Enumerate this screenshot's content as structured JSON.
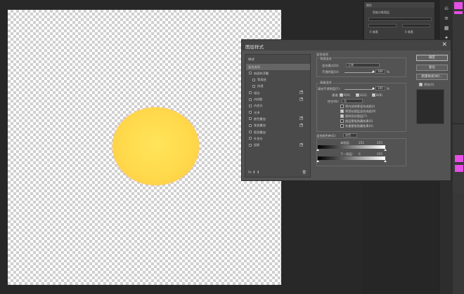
{
  "colors": {
    "sun_core": "#ffe45a",
    "sun_edge": "#f9b560",
    "accent_magenta": "#e54fe5"
  },
  "properties_panel": {
    "title": "属性",
    "subtitle": "智能对象图层",
    "field_a": "0 像素",
    "field_b": "0 像素"
  },
  "dialog": {
    "title": "图层样式",
    "sidebar_title": "样式",
    "sidebar_items": [
      {
        "label": "混合选项",
        "checkbox": false,
        "active": true,
        "sub": false,
        "plus": false
      },
      {
        "label": "斜面和浮雕",
        "checkbox": true,
        "active": false,
        "sub": false,
        "plus": false
      },
      {
        "label": "等高线",
        "checkbox": true,
        "active": false,
        "sub": true,
        "plus": false
      },
      {
        "label": "纹理",
        "checkbox": true,
        "active": false,
        "sub": true,
        "plus": false
      },
      {
        "label": "描边",
        "checkbox": true,
        "active": false,
        "sub": false,
        "plus": true
      },
      {
        "label": "内阴影",
        "checkbox": true,
        "active": false,
        "sub": false,
        "plus": true
      },
      {
        "label": "内发光",
        "checkbox": true,
        "active": false,
        "sub": false,
        "plus": false
      },
      {
        "label": "光泽",
        "checkbox": true,
        "active": false,
        "sub": false,
        "plus": false
      },
      {
        "label": "颜色叠加",
        "checkbox": true,
        "active": false,
        "sub": false,
        "plus": true
      },
      {
        "label": "渐变叠加",
        "checkbox": true,
        "active": false,
        "sub": false,
        "plus": true
      },
      {
        "label": "图案叠加",
        "checkbox": true,
        "active": false,
        "sub": false,
        "plus": false
      },
      {
        "label": "外发光",
        "checkbox": true,
        "active": false,
        "sub": false,
        "plus": false
      },
      {
        "label": "投影",
        "checkbox": true,
        "active": false,
        "sub": false,
        "plus": true
      }
    ],
    "sidebar_footer": "fx ⬆ ⬇",
    "blend": {
      "section_title": "混合选项",
      "general_title": "常规混合",
      "mode_label": "混合模式(D):",
      "mode_value": "正常",
      "opacity_label": "不透明度(O):",
      "opacity_value": "100",
      "opacity_unit": "%",
      "advanced_title": "高级混合",
      "fill_label": "填充不透明度(F):",
      "fill_value": "100",
      "fill_unit": "%",
      "channels_label": "通道:",
      "channel_r": "R(R)",
      "channel_g": "G(G)",
      "channel_b": "B(B)",
      "knockout_label": "挖空(N):",
      "knockout_value": "无",
      "options": [
        {
          "label": "将内部效果混合成组(I)",
          "checked": false
        },
        {
          "label": "将剪贴图层混合成组(P)",
          "checked": true
        },
        {
          "label": "透明形状图层(T)",
          "checked": true
        },
        {
          "label": "图层蒙版隐藏效果(S)",
          "checked": false
        },
        {
          "label": "矢量蒙版隐藏效果(H)",
          "checked": false
        }
      ],
      "blend_if_label": "混合颜色带(E):",
      "blend_if_value": "灰色",
      "this_layer_label": "本图层:",
      "this_layer_min": "251",
      "this_layer_max": "255",
      "under_layer_label": "下一图层:",
      "under_layer_min": "0",
      "under_layer_max": "255"
    },
    "buttons": {
      "ok": "确定",
      "reset": "复位",
      "new_style": "新建样式(W)...",
      "preview": "预览(V)"
    }
  }
}
